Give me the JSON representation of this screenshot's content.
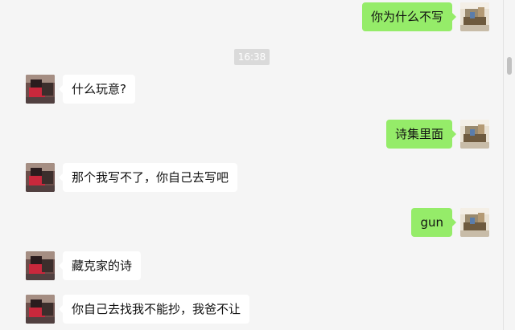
{
  "timestamp": "16:38",
  "messages": [
    {
      "side": "right",
      "text": "你为什么不写",
      "avatar": "avatar-me-icon"
    },
    {
      "side": "left",
      "text": "什么玩意?",
      "avatar": "avatar-contact-icon"
    },
    {
      "side": "right",
      "text": "诗集里面",
      "avatar": "avatar-me-icon"
    },
    {
      "side": "left",
      "text": "那个我写不了，你自己去写吧",
      "avatar": "avatar-contact-icon"
    },
    {
      "side": "right",
      "text": "gun",
      "avatar": "avatar-me-icon"
    },
    {
      "side": "left",
      "text": "藏克家的诗",
      "avatar": "avatar-contact-icon"
    },
    {
      "side": "left",
      "text": "你自己去找我不能抄，我爸不让",
      "avatar": "avatar-contact-icon"
    }
  ],
  "colors": {
    "outgoing_bubble": "#95ec69",
    "incoming_bubble": "#ffffff",
    "background": "#f5f5f5",
    "timestamp_bg": "#dadada"
  }
}
